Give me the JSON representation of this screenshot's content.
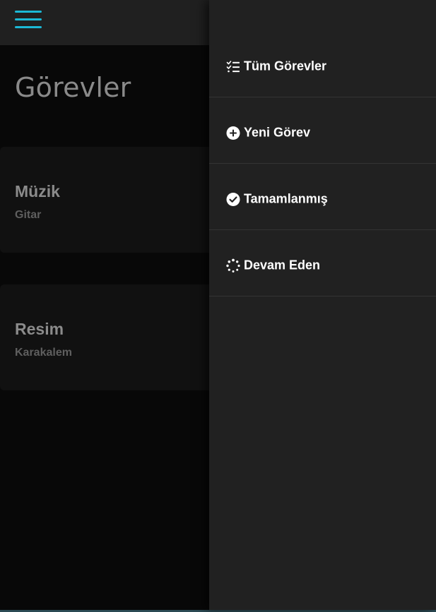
{
  "header": {
    "menu_icon": "hamburger-menu-icon",
    "accent_color": "#1bb8d6"
  },
  "page": {
    "title": "Görevler"
  },
  "tasks": [
    {
      "title": "Müzik",
      "subtitle": "Gitar"
    },
    {
      "title": "Resim",
      "subtitle": "Karakalem"
    }
  ],
  "drawer": {
    "items": [
      {
        "label": "Tüm Görevler",
        "icon": "list-check-icon"
      },
      {
        "label": "Yeni Görev",
        "icon": "plus-circle-icon"
      },
      {
        "label": "Tamamlanmış",
        "icon": "check-circle-icon"
      },
      {
        "label": "Devam Eden",
        "icon": "spinner-icon"
      }
    ]
  }
}
